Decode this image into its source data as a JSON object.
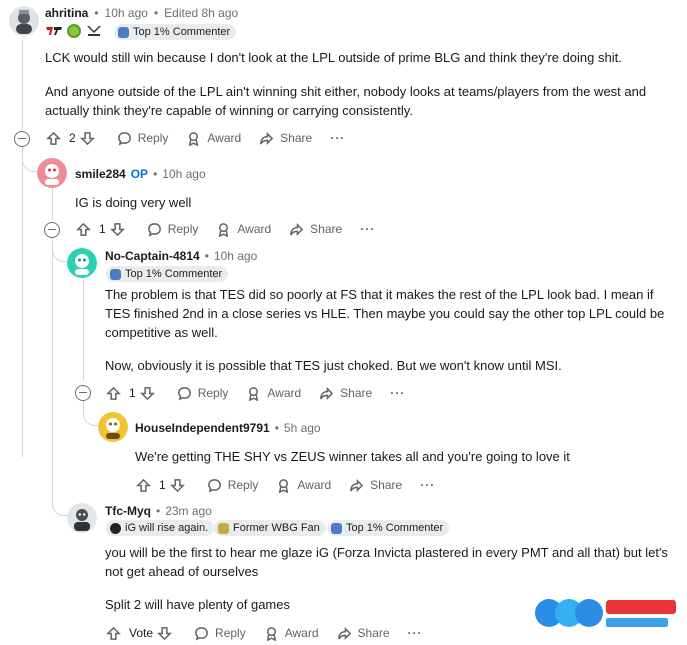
{
  "comments": [
    {
      "username": "ahritina",
      "time": "10h ago",
      "edited": "Edited 8h ago",
      "flair": "Top 1% Commenter",
      "paragraphs": [
        "LCK would still win because I don't look at the LPL outside of prime BLG and think they're doing shit.",
        "And anyone outside of the LPL ain't winning shit either, nobody looks at teams/players from the west and actually think they're capable of winning or carrying consistently."
      ],
      "votes": "2"
    },
    {
      "username": "smile284",
      "op": "OP",
      "time": "10h ago",
      "paragraphs": [
        "IG is doing very well"
      ],
      "votes": "1"
    },
    {
      "username": "No-Captain-4814",
      "time": "10h ago",
      "flair": "Top 1% Commenter",
      "paragraphs": [
        "The problem is that TES did so poorly at FS that it makes the rest of the LPL look bad. I mean if TES finished 2nd in a close series vs HLE. Then maybe you could say the other top LPL could be competitive as well.",
        "Now, obviously it is possible that TES just choked. But we won't know until MSI."
      ],
      "votes": "1"
    },
    {
      "username": "HouseIndependent9791",
      "time": "5h ago",
      "paragraphs": [
        "We're getting THE SHY vs ZEUS winner takes all and you're going to love it"
      ],
      "votes": "1"
    },
    {
      "username": "Tfc-Myq",
      "time": "23m ago",
      "flairs": [
        "iG will rise again.",
        "Former WBG Fan",
        "Top 1% Commenter"
      ],
      "paragraphs": [
        "you will be the first to hear me glaze iG (Forza Invicta plastered in every PMT and all that) but let's not get ahead of ourselves",
        "Split 2 will have plenty of games"
      ],
      "votes": "Vote"
    }
  ],
  "actions": {
    "reply": "Reply",
    "award": "Award",
    "share": "Share",
    "more": "···"
  },
  "separator": "•",
  "colors": {
    "op_blue": "#0a6fd6",
    "meta_gray": "#6b6f73",
    "thread_line": "#d4d7da"
  }
}
